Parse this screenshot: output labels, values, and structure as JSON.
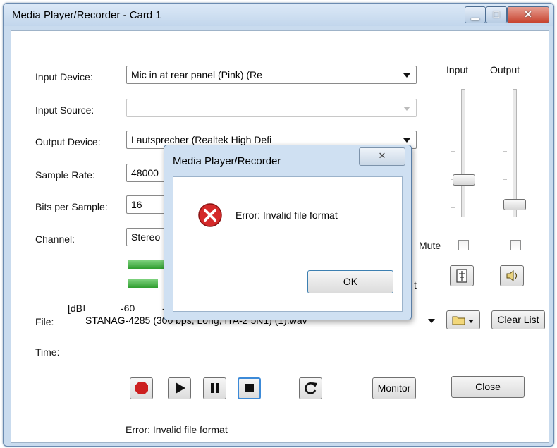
{
  "window": {
    "title": "Media Player/Recorder  - Card 1"
  },
  "form": {
    "input_device_label": "Input Device:",
    "input_device_value": "Mic in at rear panel (Pink) (Re",
    "input_source_label": "Input Source:",
    "input_source_value": "",
    "output_device_label": "Output Device:",
    "output_device_value": "Lautsprecher (Realtek High Defi",
    "sample_rate_label": "Sample Rate:",
    "sample_rate_value": "48000",
    "bits_label": "Bits per Sample:",
    "bits_value": "16",
    "channel_label": "Channel:",
    "channel_value": "Stereo"
  },
  "levels": {
    "db_label": "[dB]",
    "scale_start": "-60",
    "scale_next": "-",
    "trailing_char": "t"
  },
  "mixer": {
    "input_label": "Input",
    "output_label": "Output",
    "mute_label": "Mute"
  },
  "file": {
    "label": "File:",
    "value": "STANAG-4285 (300 bps, Long, ITA-2 5N1) (1).wav",
    "clear_list_label": "Clear List",
    "time_label": "Time:"
  },
  "transport": {
    "monitor_label": "Monitor",
    "close_label": "Close"
  },
  "status": {
    "text": "Error: Invalid file format"
  },
  "dialog": {
    "title": "Media Player/Recorder",
    "message": "Error: Invalid file format",
    "ok_label": "OK"
  },
  "icons": {
    "record": "record-icon",
    "play": "play-icon",
    "pause": "pause-icon",
    "stop": "stop-icon",
    "repeat": "repeat-icon",
    "folder": "folder-icon",
    "error": "error-icon"
  },
  "colors": {
    "record": "#cc1f1f",
    "meter": "#3aa83a",
    "error": "#d42a2a"
  }
}
